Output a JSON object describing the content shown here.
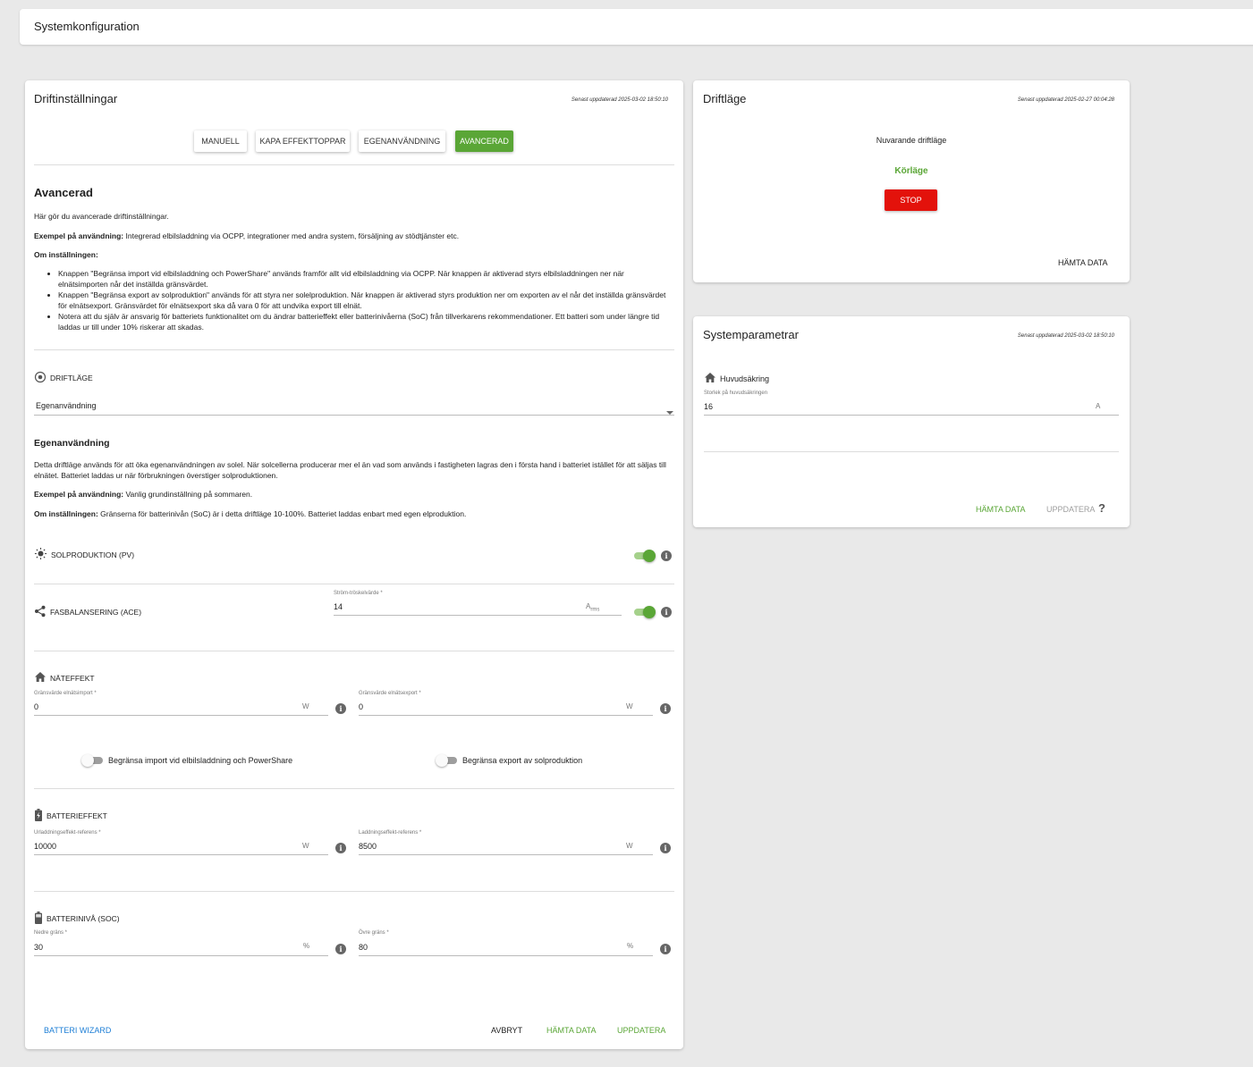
{
  "colors": {
    "accent": "#5aa636",
    "stop": "#e3120b",
    "link_blue": "#1e7fd6",
    "disabled": "#9e9e9e"
  },
  "topbar": {
    "title": "Systemkonfiguration"
  },
  "drift": {
    "title": "Driftinställningar",
    "updated": "Senast uppdaterad 2025-03-02 18:50:10",
    "modes": [
      "MANUELL",
      "KAPA EFFEKTTOPPAR",
      "EGENANVÄNDNING",
      "AVANCERAD"
    ],
    "active_mode": "AVANCERAD",
    "heading": "Avancerad",
    "intro": "Här gör du avancerade driftinställningar.",
    "example_label": "Exempel på användning:",
    "example_text": " Integrerad elbilsladdning via OCPP, integrationer med andra system, försäljning av stödtjänster etc.",
    "settings_label": "Om inställningen:",
    "bullets": [
      "Knappen \"Begränsa import vid elbilsladdning och PowerShare\" används framför allt vid elbilsladdning via OCPP. När knappen är aktiverad styrs elbilsladdningen ner när elnätsimporten når det inställda gränsvärdet.",
      "Knappen \"Begränsa export av solproduktion\" används för att styra ner solelproduktion. När knappen är aktiverad styrs produktion ner om exporten av el når det inställda gränsvärdet för elnätsexport. Gränsvärdet för elnätsexport ska då vara 0 för att undvika export till elnät.",
      "Notera att du själv är ansvarig för batteriets funktionalitet om du ändrar batterieffekt eller batterinivåerna (SoC) från tillverkarens rekommendationer. Ett batteri som under längre tid laddas ur till under 10% riskerar att skadas."
    ],
    "driftlage_label": "DRIFTLÄGE",
    "driftlage_value": "Egenanvändning",
    "sub_heading": "Egenanvändning",
    "sub_desc": "Detta driftläge används för att öka egenanvändningen av solel. När solcellerna producerar mer el än vad som används i fastigheten lagras den i första hand i batteriet istället för att säljas till elnätet. Batteriet laddas ur när förbrukningen överstiger solproduktionen.",
    "sub_example_label": "Exempel på användning:",
    "sub_example_text": " Vanlig grundinställning på sommaren.",
    "sub_settings_label": "Om inställningen:",
    "sub_settings_text": " Gränserna för batterinivån (SoC) är i detta driftläge 10-100%. Batteriet laddas enbart med egen elproduktion.",
    "solar_label": "SOLPRODUKTION (PV)",
    "solar_on": true,
    "ace_label": "FASBALANSERING (ACE)",
    "ace_field_label": "Ström-tröskelvärde *",
    "ace_value": "14",
    "ace_unit": "A",
    "ace_unit_sub": "rms",
    "ace_on": true,
    "grid_label": "NÄTEFFEKT",
    "import_label": "Gränsvärde elnätsimport *",
    "import_value": "0",
    "import_unit": "W",
    "export_label": "Gränsvärde elnätsexport *",
    "export_value": "0",
    "export_unit": "W",
    "limit_import_label": "Begränsa import vid elbilsladdning och PowerShare",
    "limit_import_on": false,
    "limit_export_label": "Begränsa export av solproduktion",
    "limit_export_on": false,
    "battery_power_label": "BATTERIEFFEKT",
    "discharge_label": "Urladdningseffekt-referens *",
    "discharge_value": "10000",
    "discharge_unit": "W",
    "charge_label": "Laddningseffekt-referens *",
    "charge_value": "8500",
    "charge_unit": "W",
    "soc_label": "BATTERINIVÅ (SOC)",
    "lower_label": "Nedre gräns *",
    "lower_value": "30",
    "lower_unit": "%",
    "upper_label": "Övre gräns *",
    "upper_value": "80",
    "upper_unit": "%",
    "wizard": "BATTERI WIZARD",
    "cancel": "AVBRYT",
    "fetch": "HÄMTA DATA",
    "update": "UPPDATERA"
  },
  "driftlage": {
    "title": "Driftläge",
    "updated": "Senast uppdaterad 2025-02-27 00:04:28",
    "current_label": "Nuvarande driftläge",
    "current_value": "Körläge",
    "stop": "STOP",
    "fetch": "HÄMTA DATA"
  },
  "sysparams": {
    "title": "Systemparametrar",
    "updated": "Senast uppdaterad 2025-03-02 18:50:10",
    "fuse_label": "Huvudsäkring",
    "fuse_field_label": "Storlek på huvudsäkringen",
    "fuse_value": "16",
    "fuse_unit": "A",
    "fetch": "HÄMTA DATA",
    "update": "UPPDATERA",
    "help": "?"
  }
}
